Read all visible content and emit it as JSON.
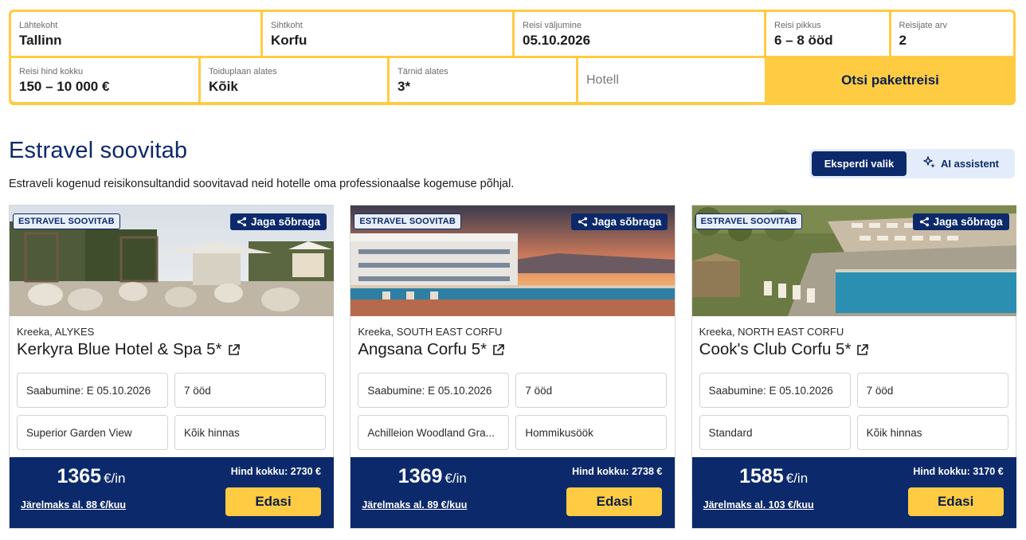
{
  "search": {
    "fields": [
      {
        "label": "Lähtekoht",
        "value": "Tallinn"
      },
      {
        "label": "Sihtkoht",
        "value": "Korfu"
      },
      {
        "label": "Reisi väljumine",
        "value": "05.10.2026"
      },
      {
        "label": "Reisi pikkus",
        "value": "6 – 8 ööd"
      },
      {
        "label": "Reisijate arv",
        "value": "2"
      },
      {
        "label": "Reisi hind kokku",
        "value": "150 – 10 000 €"
      },
      {
        "label": "Toiduplaan alates",
        "value": "Kõik"
      },
      {
        "label": "Tärnid alates",
        "value": "3*"
      }
    ],
    "hotel_placeholder": "Hotell",
    "search_button": "Otsi pakettreisi"
  },
  "section": {
    "title": "Estravel soovitab",
    "subtitle": "Estraveli kogenud reisikonsultandid soovitavad neid hotelle oma professionaalse kogemuse põhjal.",
    "toggle": {
      "expert": "Eksperdi valik",
      "ai": "AI assistent"
    }
  },
  "cards": [
    {
      "badge": "ESTRAVEL SOOVITAB",
      "share": "Jaga sõbraga",
      "location": "Kreeka, ALYKES",
      "name": "Kerkyra Blue Hotel & Spa 5*",
      "arrival": "Saabumine: E 05.10.2026",
      "nights": "7 ööd",
      "room": "Superior Garden View",
      "board": "Kõik hinnas",
      "price": "1365",
      "price_unit": "€/in",
      "installment": "Järelmaks al. 88 €/kuu",
      "total": "Hind kokku: 2730 €",
      "button": "Edasi"
    },
    {
      "badge": "ESTRAVEL SOOVITAB",
      "share": "Jaga sõbraga",
      "location": "Kreeka, SOUTH EAST CORFU",
      "name": "Angsana Corfu 5*",
      "arrival": "Saabumine: E 05.10.2026",
      "nights": "7 ööd",
      "room": "Achilleion Woodland Gra...",
      "board": "Hommikusöök",
      "price": "1369",
      "price_unit": "€/in",
      "installment": "Järelmaks al. 89 €/kuu",
      "total": "Hind kokku: 2738 €",
      "button": "Edasi"
    },
    {
      "badge": "ESTRAVEL SOOVITAB",
      "share": "Jaga sõbraga",
      "location": "Kreeka, NORTH EAST CORFU",
      "name": "Cook's Club Corfu 5*",
      "arrival": "Saabumine: E 05.10.2026",
      "nights": "7 ööd",
      "room": "Standard",
      "board": "Kõik hinnas",
      "price": "1585",
      "price_unit": "€/in",
      "installment": "Järelmaks al. 103 €/kuu",
      "total": "Hind kokku: 3170 €",
      "button": "Edasi"
    }
  ],
  "icons": {
    "share": "share-icon",
    "external": "external-link-icon",
    "ai": "sparkle-icon"
  },
  "colors": {
    "accent": "#ffcb43",
    "navy": "#0c2a6b"
  }
}
